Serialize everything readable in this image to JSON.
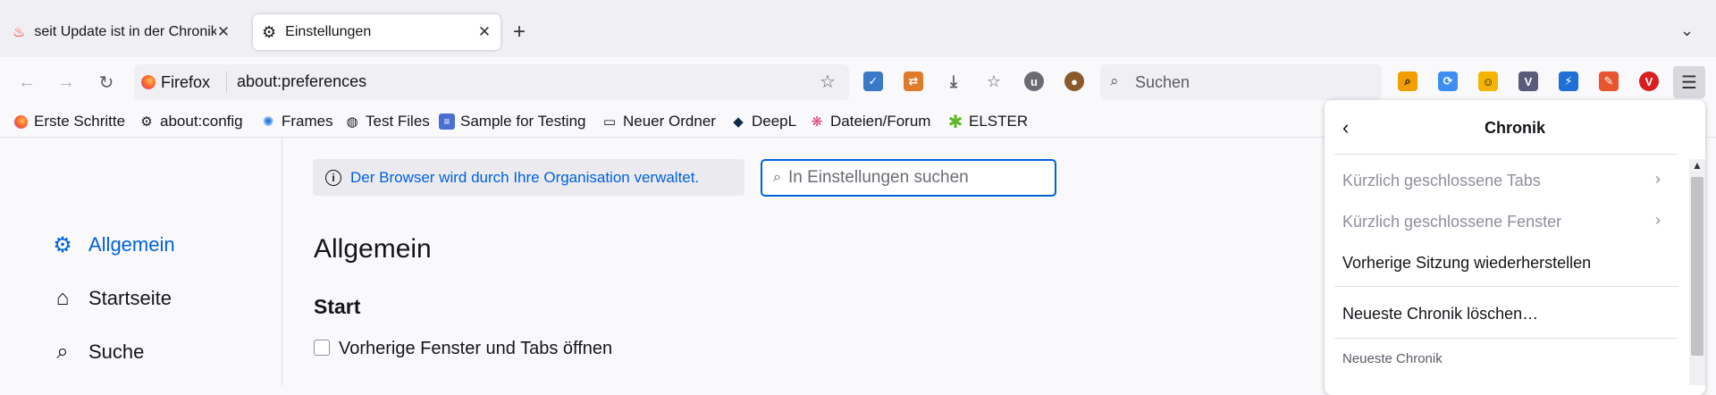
{
  "tabs": [
    {
      "title": "seit Update ist in der Chronik",
      "icon": "fire-icon",
      "active": false
    },
    {
      "title": "Einstellungen",
      "icon": "gear-icon",
      "active": true
    }
  ],
  "nav": {
    "identity_label": "Firefox",
    "url": "about:preferences",
    "search_placeholder": "Suchen"
  },
  "extensions": [
    {
      "name": "w3c-validator-icon",
      "color": "#3a78c8",
      "glyph": "✓"
    },
    {
      "name": "translate-icon",
      "color": "#e07b2c",
      "glyph": "⇄"
    },
    {
      "name": "download-icon",
      "color": "#5b5b66",
      "glyph": "⤓"
    },
    {
      "name": "pocket-icon",
      "color": "#5b5b66",
      "glyph": "☆"
    },
    {
      "name": "ublock-icon",
      "color": "#6b6b75",
      "glyph": "u"
    },
    {
      "name": "cookie-icon",
      "color": "#8a5a2b",
      "glyph": "●"
    },
    {
      "name": "zoom-icon",
      "color": "#f29d00",
      "glyph": "⌕"
    },
    {
      "name": "sync-icon",
      "color": "#3c8ef3",
      "glyph": "⟳"
    },
    {
      "name": "emoji-icon",
      "color": "#f5b400",
      "glyph": "☺"
    },
    {
      "name": "v-icon",
      "color": "#5a5a7a",
      "glyph": "V"
    },
    {
      "name": "bolt-icon",
      "color": "#1f6fd6",
      "glyph": "⚡"
    },
    {
      "name": "edit-icon",
      "color": "#e8542f",
      "glyph": "✎"
    },
    {
      "name": "vivaldi-icon",
      "color": "#d81e1e",
      "glyph": "V"
    }
  ],
  "bookmarks": [
    {
      "label": "Erste Schritte",
      "icon": "firefox-icon"
    },
    {
      "label": "about:config",
      "icon": "gear-icon"
    },
    {
      "label": "Frames",
      "icon": "frames-icon"
    },
    {
      "label": "Test Files",
      "icon": "globe-icon"
    },
    {
      "label": "Sample for Testing",
      "icon": "doc-icon"
    },
    {
      "label": "Neuer Ordner",
      "icon": "folder-icon"
    },
    {
      "label": "DeepL",
      "icon": "deepl-icon"
    },
    {
      "label": "Dateien/Forum",
      "icon": "forum-icon"
    },
    {
      "label": "ELSTER",
      "icon": "elster-icon"
    }
  ],
  "sidebar": {
    "categories": [
      {
        "label": "Allgemein",
        "icon": "gear-icon",
        "selected": true
      },
      {
        "label": "Startseite",
        "icon": "home-icon",
        "selected": false
      },
      {
        "label": "Suche",
        "icon": "search-icon",
        "selected": false
      }
    ]
  },
  "main": {
    "policy_notice": "Der Browser wird durch Ihre Organisation verwaltet.",
    "search_placeholder": "In Einstellungen suchen",
    "heading": "Allgemein",
    "section_start": "Start",
    "restore_checkbox_label": "Vorherige Fenster und Tabs öffnen",
    "restore_checked": false
  },
  "panel": {
    "title": "Chronik",
    "items": [
      {
        "label": "Kürzlich geschlossene Tabs",
        "disabled": true,
        "submenu": true
      },
      {
        "label": "Kürzlich geschlossene Fenster",
        "disabled": true,
        "submenu": true
      },
      {
        "label": "Vorherige Sitzung wiederherstellen",
        "disabled": false,
        "submenu": false
      },
      {
        "label": "Neueste Chronik löschen…",
        "disabled": false,
        "submenu": false
      }
    ],
    "section_heading": "Neueste Chronik"
  },
  "colors": {
    "accent": "#0061e0",
    "text": "#15141a",
    "disabled": "#8f8f9d"
  }
}
